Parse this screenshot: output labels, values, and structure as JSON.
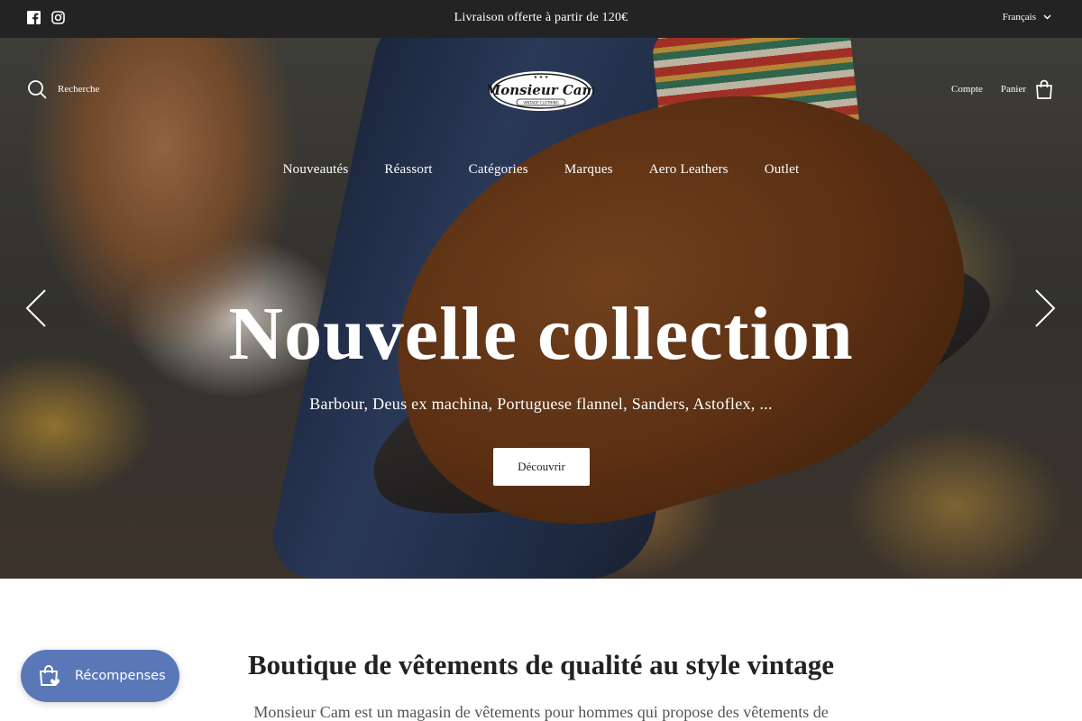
{
  "topbar": {
    "announcement": "Livraison offerte à partir de 120€",
    "language": "Français",
    "social_icons": [
      "facebook-icon",
      "instagram-icon"
    ],
    "background": "#232323"
  },
  "header": {
    "search_label": "Recherche",
    "account_label": "Compte",
    "cart_label": "Panier",
    "logo_text": "Monsieur Cam",
    "logo_subtext": "VINTAGE CLOTHING"
  },
  "nav": {
    "items": [
      {
        "label": "Nouveautés"
      },
      {
        "label": "Réassort"
      },
      {
        "label": "Catégories"
      },
      {
        "label": "Marques"
      },
      {
        "label": "Aero Leathers"
      },
      {
        "label": "Outlet"
      }
    ]
  },
  "hero": {
    "title": "Nouvelle collection",
    "subtitle": "Barbour, Deus ex machina, Portuguese flannel, Sanders, Astoflex, ...",
    "button_label": "Découvrir"
  },
  "intro": {
    "title": "Boutique de vêtements de qualité au style vintage",
    "text": "Monsieur Cam est un magasin de vêtements pour hommes qui propose des vêtements de"
  },
  "rewards": {
    "label": "Récompenses",
    "color": "#5a78b8"
  }
}
